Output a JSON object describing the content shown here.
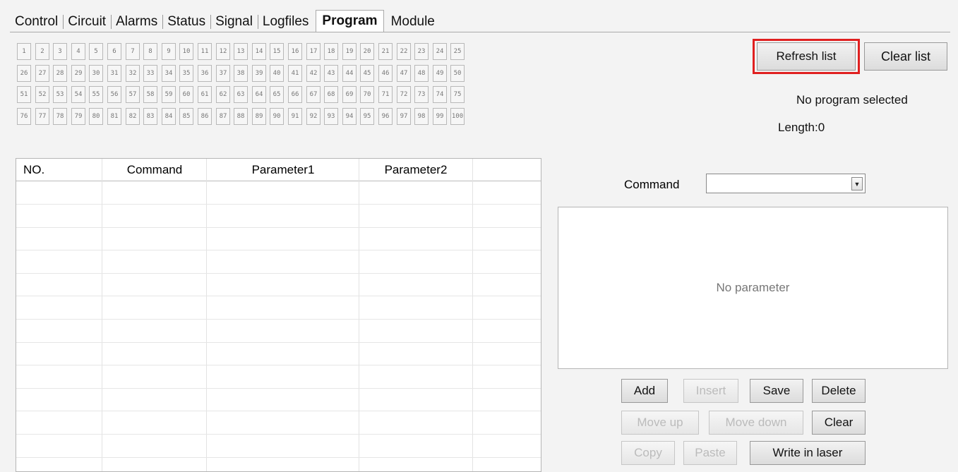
{
  "tabs": [
    "Control",
    "Circuit",
    "Alarms",
    "Status",
    "Signal",
    "Logfiles",
    "Program",
    "Module"
  ],
  "active_tab": "Program",
  "program_slots": [
    "1",
    "2",
    "3",
    "4",
    "5",
    "6",
    "7",
    "8",
    "9",
    "10",
    "11",
    "12",
    "13",
    "14",
    "15",
    "16",
    "17",
    "18",
    "19",
    "20",
    "21",
    "22",
    "23",
    "24",
    "25",
    "26",
    "27",
    "28",
    "29",
    "30",
    "31",
    "32",
    "33",
    "34",
    "35",
    "36",
    "37",
    "38",
    "39",
    "40",
    "41",
    "42",
    "43",
    "44",
    "45",
    "46",
    "47",
    "48",
    "49",
    "50",
    "51",
    "52",
    "53",
    "54",
    "55",
    "56",
    "57",
    "58",
    "59",
    "60",
    "61",
    "62",
    "63",
    "64",
    "65",
    "66",
    "67",
    "68",
    "69",
    "70",
    "71",
    "72",
    "73",
    "74",
    "75",
    "76",
    "77",
    "78",
    "79",
    "80",
    "81",
    "82",
    "83",
    "84",
    "85",
    "86",
    "87",
    "88",
    "89",
    "90",
    "91",
    "92",
    "93",
    "94",
    "95",
    "96",
    "97",
    "98",
    "99",
    "100"
  ],
  "buttons": {
    "refresh": "Refresh list",
    "clear_list": "Clear list",
    "add": "Add",
    "insert": "Insert",
    "save": "Save",
    "delete": "Delete",
    "move_up": "Move up",
    "move_down": "Move down",
    "clear": "Clear",
    "copy": "Copy",
    "paste": "Paste",
    "write": "Write in laser"
  },
  "status": {
    "program": "No program selected",
    "length": "Length:0"
  },
  "table": {
    "headers": [
      "NO.",
      "Command",
      "Parameter1",
      "Parameter2"
    ]
  },
  "command": {
    "label": "Command",
    "value": ""
  },
  "parameter_placeholder": "No parameter",
  "colors": {
    "highlight": "#e02020"
  }
}
